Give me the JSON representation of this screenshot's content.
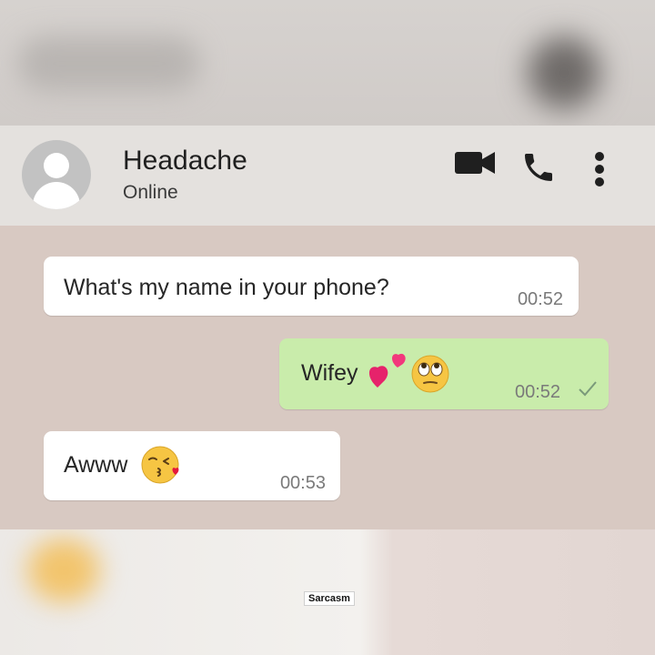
{
  "contact": {
    "name": "Headache",
    "status": "Online"
  },
  "header_icons": [
    "video-camera-icon",
    "phone-icon",
    "more-vertical-icon"
  ],
  "messages": [
    {
      "direction": "incoming",
      "text": "What's my name in your phone?",
      "time": "00:52"
    },
    {
      "direction": "outgoing",
      "text": "Wifey",
      "emojis": [
        "two-hearts-emoji",
        "eye-roll-emoji"
      ],
      "time": "00:52",
      "status": "sent"
    },
    {
      "direction": "incoming",
      "text": "Awww",
      "emojis": [
        "kissing-heart-emoji"
      ],
      "time": "00:53"
    }
  ],
  "colors": {
    "incoming_bubble": "#ffffff",
    "outgoing_bubble": "#c9ecab",
    "chat_background": "#d8c9c2"
  },
  "watermark": "Sarcasm"
}
